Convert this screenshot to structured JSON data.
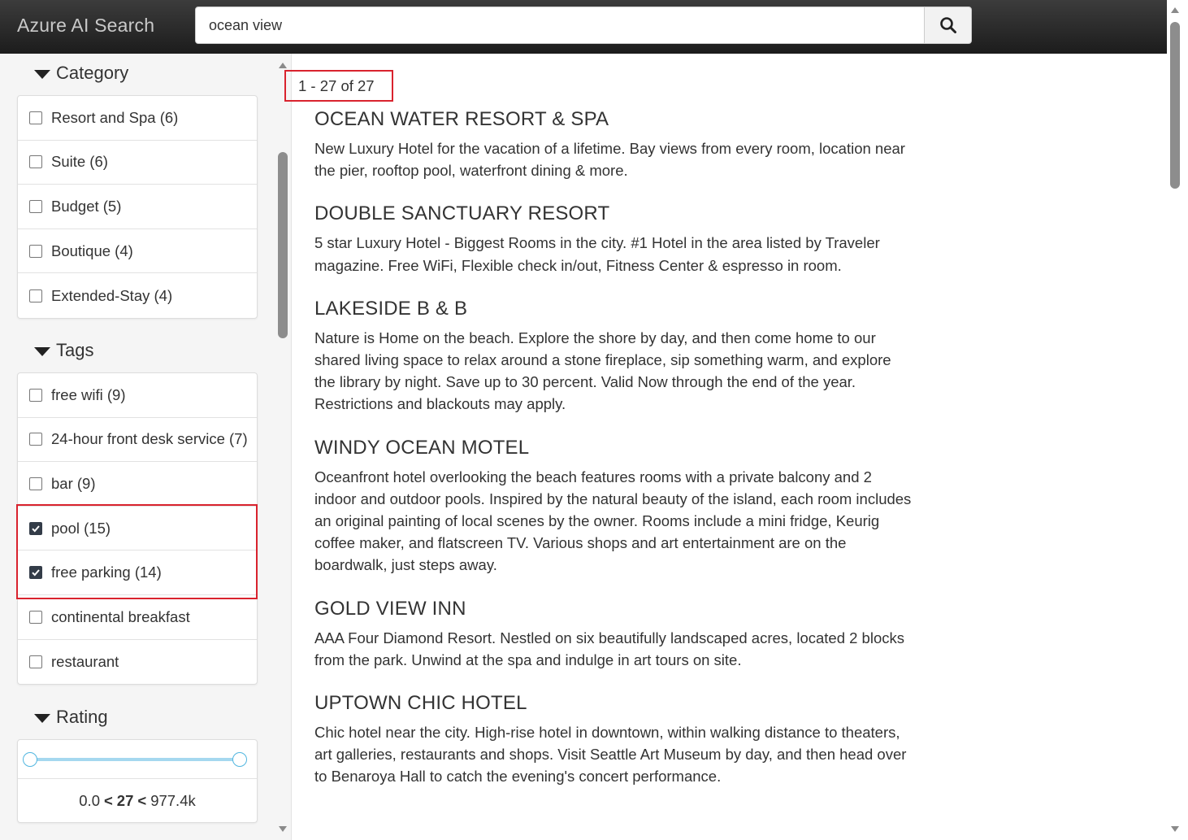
{
  "header": {
    "brand": "Azure AI Search",
    "search_value": "ocean view"
  },
  "facets": {
    "category": {
      "title": "Category",
      "items": [
        {
          "label": "Resort and Spa (6)",
          "checked": false
        },
        {
          "label": "Suite (6)",
          "checked": false
        },
        {
          "label": "Budget (5)",
          "checked": false
        },
        {
          "label": "Boutique (4)",
          "checked": false
        },
        {
          "label": "Extended-Stay (4)",
          "checked": false
        }
      ]
    },
    "tags": {
      "title": "Tags",
      "items": [
        {
          "label": "free wifi (9)",
          "checked": false
        },
        {
          "label": "24-hour front desk service (7)",
          "checked": false
        },
        {
          "label": "bar (9)",
          "checked": false
        },
        {
          "label": "pool (15)",
          "checked": true
        },
        {
          "label": "free parking (14)",
          "checked": true
        },
        {
          "label": "continental breakfast",
          "checked": false
        },
        {
          "label": "restaurant",
          "checked": false
        }
      ]
    },
    "rating": {
      "title": "Rating",
      "min": "0.0",
      "count": "27",
      "max": "977.4k",
      "separator": "<"
    }
  },
  "results": {
    "count_label": "1 - 27 of 27",
    "items": [
      {
        "title": "OCEAN WATER RESORT & SPA",
        "description": "New Luxury Hotel for the vacation of a lifetime. Bay views from every room, location near the pier, rooftop pool, waterfront dining & more."
      },
      {
        "title": "DOUBLE SANCTUARY RESORT",
        "description": "5 star Luxury Hotel - Biggest Rooms in the city. #1 Hotel in the area listed by Traveler magazine. Free WiFi, Flexible check in/out, Fitness Center & espresso in room."
      },
      {
        "title": "LAKESIDE B & B",
        "description": "Nature is Home on the beach. Explore the shore by day, and then come home to our shared living space to relax around a stone fireplace, sip something warm, and explore the library by night. Save up to 30 percent. Valid Now through the end of the year. Restrictions and blackouts may apply."
      },
      {
        "title": "WINDY OCEAN MOTEL",
        "description": "Oceanfront hotel overlooking the beach features rooms with a private balcony and 2 indoor and outdoor pools. Inspired by the natural beauty of the island, each room includes an original painting of local scenes by the owner. Rooms include a mini fridge, Keurig coffee maker, and flatscreen TV. Various shops and art entertainment are on the boardwalk, just steps away."
      },
      {
        "title": "GOLD VIEW INN",
        "description": "AAA Four Diamond Resort. Nestled on six beautifully landscaped acres, located 2 blocks from the park. Unwind at the spa and indulge in art tours on site."
      },
      {
        "title": "UPTOWN CHIC HOTEL",
        "description": "Chic hotel near the city. High-rise hotel in downtown, within walking distance to theaters, art galleries, restaurants and shops. Visit Seattle Art Museum by day, and then head over to Benaroya Hall to catch the evening's concert performance."
      }
    ]
  }
}
